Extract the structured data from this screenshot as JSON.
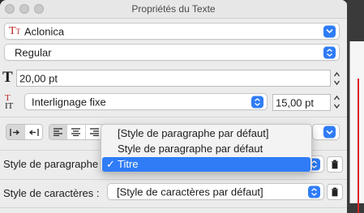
{
  "window": {
    "title": "Propriétés du Texte"
  },
  "font": {
    "value": "Aclonica",
    "icon": "font-icon"
  },
  "style": {
    "value": "Regular"
  },
  "size": {
    "value": "20,00 pt",
    "icon": "font-size-icon"
  },
  "line_spacing": {
    "mode": "Interlignage fixe",
    "value": "15,00 pt",
    "icon": "line-spacing-icon"
  },
  "paragraph": {
    "label": "Style de paragraphe",
    "menu": [
      {
        "label": "[Style de paragraphe par défaut]",
        "checked": false,
        "selected": false
      },
      {
        "label": "Style de paragraphe par défaut",
        "checked": false,
        "selected": false
      },
      {
        "label": "Titre",
        "checked": true,
        "selected": true
      }
    ],
    "check_glyph": "✓"
  },
  "character": {
    "label": "Style de caractères :",
    "value": "[Style de caractères par défaut]"
  },
  "colors": {
    "accent": "#2f7cf6",
    "window_bg": "#ececec",
    "canvas_bg": "#2b2b2b",
    "guide": "#dd2222"
  }
}
